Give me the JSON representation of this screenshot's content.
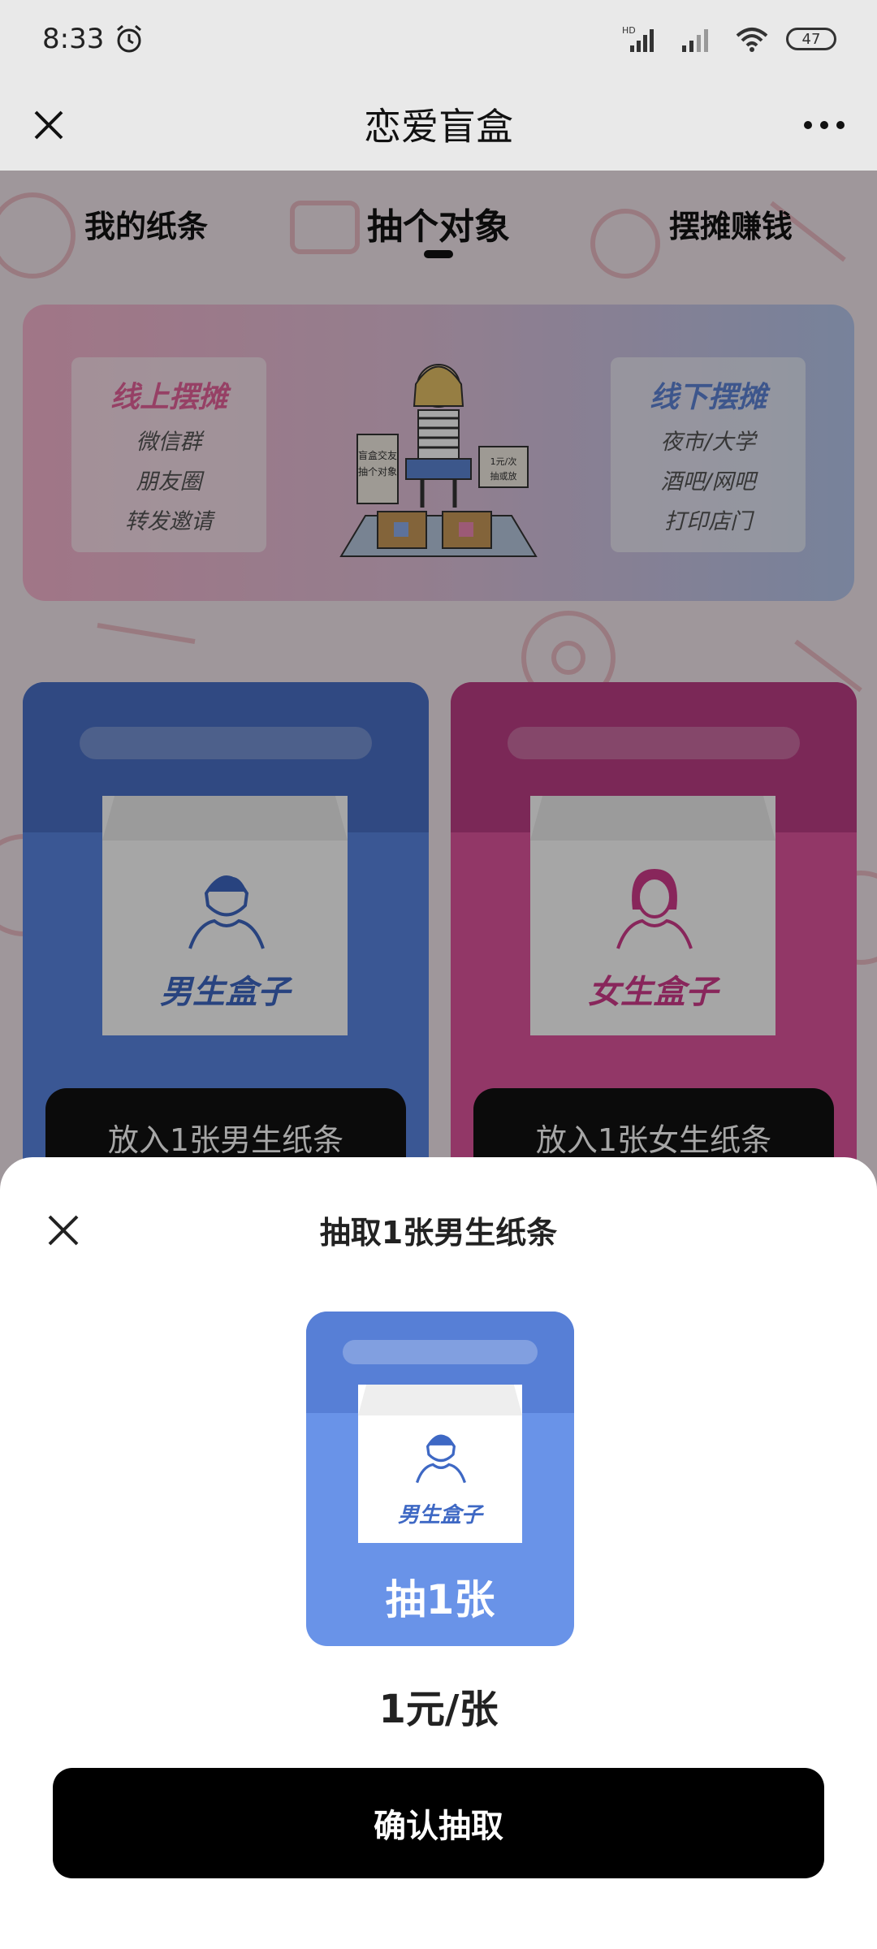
{
  "status_bar": {
    "time": "8:33",
    "alarm_icon": "alarm-clock-icon",
    "network_label": "HD",
    "battery": "47"
  },
  "topbar": {
    "title": "恋爱盲盒",
    "close_icon": "close-icon",
    "more_icon": "more-dots-icon"
  },
  "tabs": [
    {
      "label": "我的纸条",
      "active": false
    },
    {
      "label": "抽个对象",
      "active": true
    },
    {
      "label": "摆摊赚钱",
      "active": false
    }
  ],
  "banner": {
    "left": {
      "title": "线上摆摊",
      "lines": [
        "微信群",
        "朋友圈",
        "转发邀请"
      ]
    },
    "right": {
      "title": "线下摆摊",
      "lines": [
        "夜市/大学",
        "酒吧/网吧",
        "打印店门"
      ]
    },
    "sign_left": "盲盒交友 抽个对象",
    "sign_right": "1元/次 抽或放"
  },
  "boxes": {
    "male": {
      "label": "男生盒子",
      "button": "放入1张男生纸条"
    },
    "female": {
      "label": "女生盒子",
      "button": "放入1张女生纸条"
    }
  },
  "sheet": {
    "title": "抽取1张男生纸条",
    "box_label": "男生盒子",
    "draw_label": "抽1张",
    "price": "1元/张",
    "confirm": "确认抽取"
  },
  "colors": {
    "male_blue": "#5a86e4",
    "female_pink": "#e1559f",
    "button_black": "#000000"
  }
}
